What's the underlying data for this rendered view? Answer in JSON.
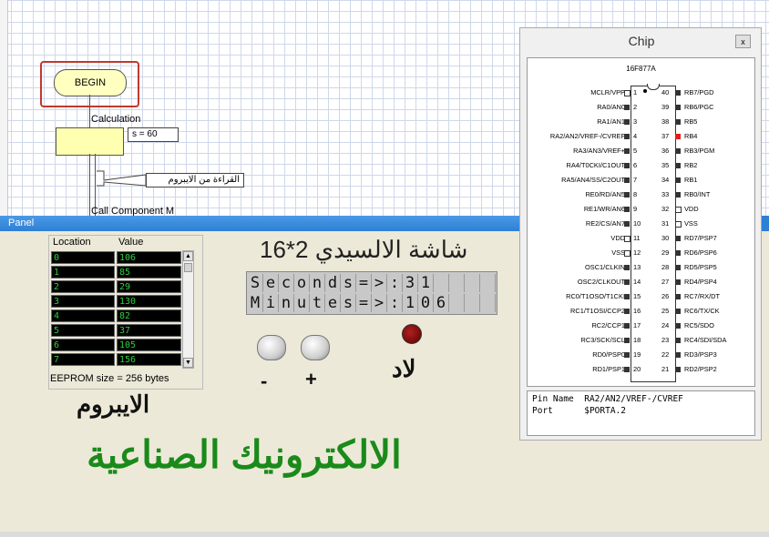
{
  "flowchart": {
    "begin_label": "BEGIN",
    "calculation_label": "Calculation",
    "calc_note": "s = 60",
    "eeprom_read_note": "القراءة من الايبروم",
    "cut_label": "Call Component M"
  },
  "panel": {
    "title": "Panel"
  },
  "eeprom": {
    "col_location": "Location",
    "col_value": "Value",
    "rows": [
      {
        "loc": "0",
        "val": "106"
      },
      {
        "loc": "1",
        "val": "85"
      },
      {
        "loc": "2",
        "val": "29"
      },
      {
        "loc": "3",
        "val": "130"
      },
      {
        "loc": "4",
        "val": "82"
      },
      {
        "loc": "5",
        "val": "37"
      },
      {
        "loc": "6",
        "val": "105"
      },
      {
        "loc": "7",
        "val": "156"
      }
    ],
    "size_text": "EEPROM size = 256 bytes"
  },
  "lcd": {
    "title": "شاشة الالسيدي 2*16",
    "line1": "Seconds=>:31",
    "line2": "Minutes=>:106",
    "columns": 16
  },
  "buttons": {
    "minus_label": "-",
    "plus_label": "+"
  },
  "led": {
    "label": "لاد",
    "color": "#b02020"
  },
  "labels": {
    "eeprom_title": "الايبروم",
    "brand": "الالكترونيك الصناعية",
    "brand_color": "#1a8a1a"
  },
  "chip": {
    "window_title": "Chip",
    "close": "x",
    "name": "16F877A",
    "left_pins": [
      {
        "n": "1",
        "label": "MCLR/VPP",
        "type": "hollow"
      },
      {
        "n": "2",
        "label": "RA0/AN0",
        "type": "solid"
      },
      {
        "n": "3",
        "label": "RA1/AN1",
        "type": "solid"
      },
      {
        "n": "4",
        "label": "RA2/AN2/VREF-/CVREF",
        "type": "solid"
      },
      {
        "n": "5",
        "label": "RA3/AN3/VREF+",
        "type": "solid"
      },
      {
        "n": "6",
        "label": "RA4/T0CKI/C1OUT",
        "type": "solid"
      },
      {
        "n": "7",
        "label": "RA5/AN4/SS/C2OUT",
        "type": "solid"
      },
      {
        "n": "8",
        "label": "RE0/RD/AN5",
        "type": "solid"
      },
      {
        "n": "9",
        "label": "RE1/WR/AN6",
        "type": "solid"
      },
      {
        "n": "10",
        "label": "RE2/CS/AN7",
        "type": "solid"
      },
      {
        "n": "11",
        "label": "VDD",
        "type": "hollow"
      },
      {
        "n": "12",
        "label": "VSS",
        "type": "hollow"
      },
      {
        "n": "13",
        "label": "OSC1/CLKIN",
        "type": "solid"
      },
      {
        "n": "14",
        "label": "OSC2/CLKOUT",
        "type": "solid"
      },
      {
        "n": "15",
        "label": "RC0/T1OSO/T1CKI",
        "type": "solid"
      },
      {
        "n": "16",
        "label": "RC1/T1OSI/CCP2",
        "type": "solid"
      },
      {
        "n": "17",
        "label": "RC2/CCP1",
        "type": "solid"
      },
      {
        "n": "18",
        "label": "RC3/SCK/SCL",
        "type": "solid"
      },
      {
        "n": "19",
        "label": "RD0/PSP0",
        "type": "solid"
      },
      {
        "n": "20",
        "label": "RD1/PSP1",
        "type": "solid"
      }
    ],
    "right_pins": [
      {
        "n": "40",
        "label": "RB7/PGD",
        "type": "solid"
      },
      {
        "n": "39",
        "label": "RB6/PGC",
        "type": "solid"
      },
      {
        "n": "38",
        "label": "RB5",
        "type": "solid"
      },
      {
        "n": "37",
        "label": "RB4",
        "type": "red"
      },
      {
        "n": "36",
        "label": "RB3/PGM",
        "type": "solid"
      },
      {
        "n": "35",
        "label": "RB2",
        "type": "solid"
      },
      {
        "n": "34",
        "label": "RB1",
        "type": "solid"
      },
      {
        "n": "33",
        "label": "RB0/INT",
        "type": "solid"
      },
      {
        "n": "32",
        "label": "VDD",
        "type": "hollow"
      },
      {
        "n": "31",
        "label": "VSS",
        "type": "hollow"
      },
      {
        "n": "30",
        "label": "RD7/PSP7",
        "type": "solid"
      },
      {
        "n": "29",
        "label": "RD6/PSP6",
        "type": "solid"
      },
      {
        "n": "28",
        "label": "RD5/PSP5",
        "type": "solid"
      },
      {
        "n": "27",
        "label": "RD4/PSP4",
        "type": "solid"
      },
      {
        "n": "26",
        "label": "RC7/RX/DT",
        "type": "solid"
      },
      {
        "n": "25",
        "label": "RC6/TX/CK",
        "type": "solid"
      },
      {
        "n": "24",
        "label": "RC5/SDO",
        "type": "solid"
      },
      {
        "n": "23",
        "label": "RC4/SDI/SDA",
        "type": "solid"
      },
      {
        "n": "22",
        "label": "RD3/PSP3",
        "type": "solid"
      },
      {
        "n": "21",
        "label": "RD2/PSP2",
        "type": "solid"
      }
    ],
    "info_pin_name_label": "Pin Name",
    "info_pin_name": "RA2/AN2/VREF-/CVREF",
    "info_port_label": "Port",
    "info_port": "$PORTA.2"
  }
}
